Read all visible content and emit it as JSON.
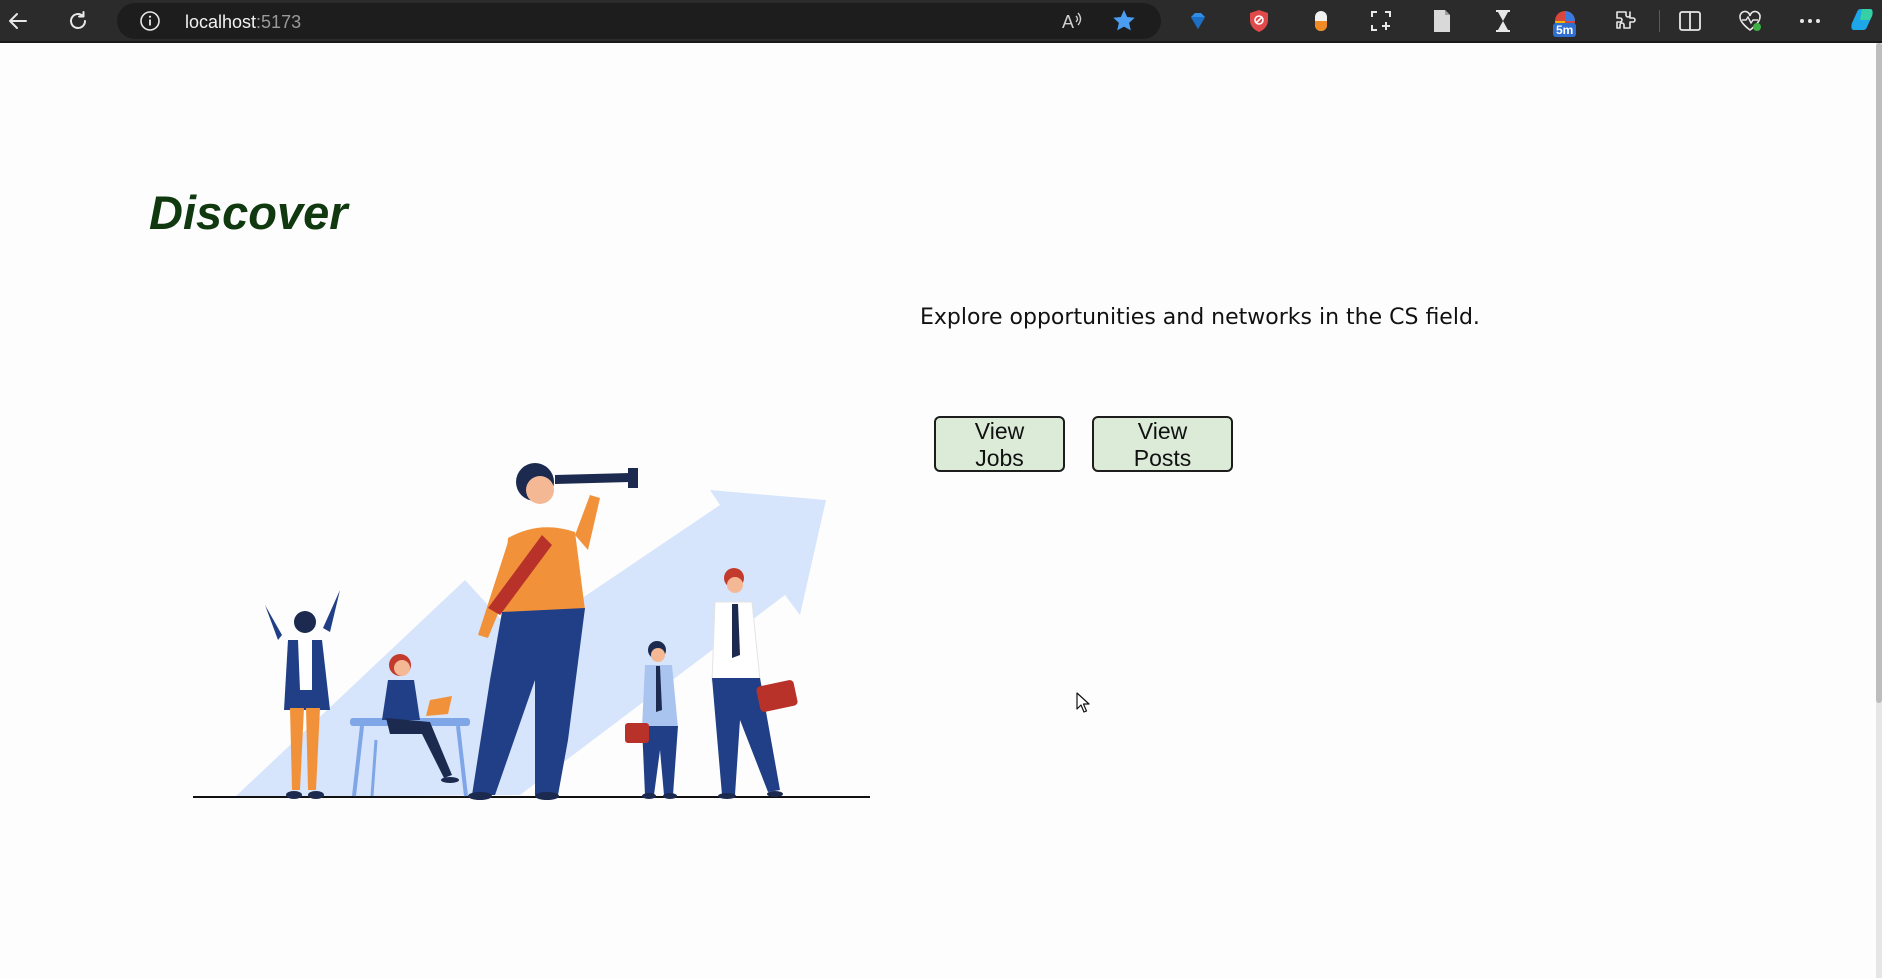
{
  "browser": {
    "address_host": "localhost",
    "address_port": ":5173",
    "tracker_badge": "5m",
    "icons": [
      "back-icon",
      "refresh-icon",
      "info-icon",
      "read-aloud-icon",
      "favorite-star-icon",
      "gem-extension-icon",
      "shield-extension-icon",
      "pill-extension-icon",
      "screenshot-icon",
      "document-icon",
      "hourglass-icon",
      "tracker-extension-icon",
      "extensions-icon",
      "split-screen-icon",
      "browser-health-icon",
      "more-icon",
      "copilot-icon"
    ]
  },
  "page": {
    "title": "Discover",
    "tagline": "Explore opportunities and networks in the CS field.",
    "view_jobs_label": "View Jobs",
    "view_posts_label": "View Posts"
  },
  "colors": {
    "title": "#10390f",
    "button_bg": "#dcebd8",
    "chrome_bg": "#2b2b2b"
  }
}
